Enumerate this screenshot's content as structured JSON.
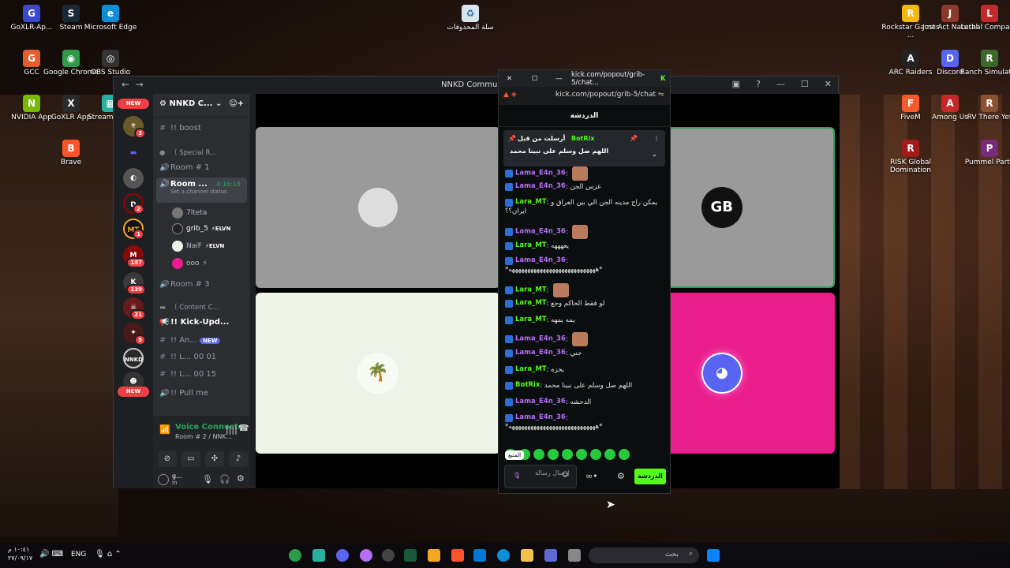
{
  "desktop_icons": [
    {
      "label": "GoXLR-Ap...",
      "color": "#3a4ad0",
      "glyph": "G",
      "col": 0,
      "row": 0
    },
    {
      "label": "Steam",
      "color": "#1b2838",
      "glyph": "S",
      "col": 1,
      "row": 0
    },
    {
      "label": "Microsoft Edge",
      "color": "#0c8fd6",
      "glyph": "e",
      "col": 2,
      "row": 0
    },
    {
      "label": "GCC",
      "color": "#e35d2f",
      "glyph": "G",
      "col": 0,
      "row": 1
    },
    {
      "label": "Google Chrome",
      "color": "#2e9b4a",
      "glyph": "◉",
      "col": 1,
      "row": 1
    },
    {
      "label": "OBS Studio",
      "color": "#333",
      "glyph": "◎",
      "col": 2,
      "row": 1
    },
    {
      "label": "NVIDIA App",
      "color": "#76b900",
      "glyph": "N",
      "col": 0,
      "row": 2
    },
    {
      "label": "GoXLR App",
      "color": "#2a2a2a",
      "glyph": "X",
      "col": 1,
      "row": 2
    },
    {
      "label": "Stream Deck",
      "color": "#2ab0a0",
      "glyph": "▦",
      "col": 2,
      "row": 2
    },
    {
      "label": "Brave",
      "color": "#fb542b",
      "glyph": "B",
      "col": 1,
      "row": 3
    }
  ],
  "recycle": "سلة المحذوفات",
  "right_icons": [
    {
      "label": "Rockstar Games ...",
      "color": "#f2b90c",
      "glyph": "R",
      "col": 0,
      "row": 0
    },
    {
      "label": "Just Act Natural",
      "color": "#8a3a2a",
      "glyph": "J",
      "col": 1,
      "row": 0
    },
    {
      "label": "Lethal Company",
      "color": "#c12a2a",
      "glyph": "L",
      "col": 2,
      "row": 0
    },
    {
      "label": "ARC Raiders",
      "color": "#222",
      "glyph": "A",
      "col": 0,
      "row": 1
    },
    {
      "label": "Discord",
      "color": "#5865f2",
      "glyph": "D",
      "col": 1,
      "row": 1
    },
    {
      "label": "Ranch Simulator",
      "color": "#3a6a2a",
      "glyph": "R",
      "col": 2,
      "row": 1
    },
    {
      "label": "FiveM",
      "color": "#f55a2a",
      "glyph": "F",
      "col": 0,
      "row": 2
    },
    {
      "label": "Among Us",
      "color": "#c62828",
      "glyph": "A",
      "col": 1,
      "row": 2
    },
    {
      "label": "RV There Yet",
      "color": "#8a5030",
      "glyph": "R",
      "col": 2,
      "row": 2
    },
    {
      "label": "RISK Global Domination",
      "color": "#a31a1a",
      "glyph": "R",
      "col": 0,
      "row": 3
    },
    {
      "label": "Pummel Party",
      "color": "#7a2a7a",
      "glyph": "P",
      "col": 2,
      "row": 3
    }
  ],
  "discord": {
    "title": "NNKD Commu",
    "server_name": "NNKD C...",
    "new_label": "NEW",
    "rail_badges": [
      "3",
      "2",
      "1",
      "187",
      "139",
      "21",
      "5"
    ],
    "channels": {
      "boost": "!! boost",
      "cat1": "〔 Special R...",
      "room1": "Room # 1",
      "room2": "Room ...",
      "room2_time": "4:16:18",
      "status": "Set a channel status",
      "users": [
        "7lteta",
        "grib_5",
        "NaiF",
        "ooo"
      ],
      "elvn": "ELVN",
      "room3": "Room # 3",
      "cat2": "〔 Content C...",
      "kick": "!! Kick-Upd...",
      "an": "!! An...",
      "an_new": "NEW",
      "l1": "!! L...",
      "l1b": "00",
      "l1c": "01",
      "l2": "!! L...",
      "l2b": "00",
      "l2c": "15",
      "pull": "!! Pull me"
    },
    "voice": {
      "status": "Voice Connecte",
      "sub": "Room # 2 / NNK..."
    },
    "user": {
      "name": "g...",
      "status": "In"
    }
  },
  "kick": {
    "window_url": "kick.com/popout/grib-5/chat...",
    "url": "kick.com/popout/grib-5/chat",
    "header": "الدردشة",
    "pin_by": "أرسلت من قبل",
    "pin_user": "BotRix",
    "pin_text": "اللهم صل وسلم على نبينا محمد",
    "messages": [
      {
        "u": "Lama_E4n_36",
        "c": "#b46ef5",
        "t": "",
        "emo": true
      },
      {
        "u": "Lama_E4n_36",
        "c": "#b46ef5",
        "t": "عرس الجن"
      },
      {
        "u": "Lara_MT",
        "c": "#53fc18",
        "t": "يمكن راح مدينه الجن الي بين العراق و",
        "t2": "ايران؟؟"
      },
      {
        "u": "Lama_E4n_36",
        "c": "#b46ef5",
        "t": "",
        "emo": true
      },
      {
        "u": "Lara_MT",
        "c": "#53fc18",
        "t": "يعهههه"
      },
      {
        "u": "Lama_E4n_36",
        "c": "#b46ef5",
        "t": "",
        "t2": "*ههههههههههههههههههههههههههههه*"
      },
      {
        "u": "Lara_MT",
        "c": "#53fc18",
        "t": "",
        "emo": true
      },
      {
        "u": "Lara_MT",
        "c": "#53fc18",
        "t": "لو فقط الحاكم وجع"
      },
      {
        "u": "Lara_MT",
        "c": "#53fc18",
        "t": "يمه يمهه"
      },
      {
        "u": "Lama_E4n_36",
        "c": "#b46ef5",
        "t": "",
        "emo": true
      },
      {
        "u": "Lama_E4n_36",
        "c": "#b46ef5",
        "t": "جني"
      },
      {
        "u": "Lara_MT",
        "c": "#53fc18",
        "t": "بخزه"
      },
      {
        "u": "BotRix",
        "c": "#53fc18",
        "t": "اللهم صل وسلم على نبينا محمد"
      },
      {
        "u": "Lama_E4n_36",
        "c": "#b46ef5",
        "t": "الدحشه"
      },
      {
        "u": "Lama_E4n_36",
        "c": "#b46ef5",
        "t": "",
        "t2": "*ههههههههههههههههههههههههههههه*"
      }
    ],
    "tooltip": "المتبع",
    "input_placeholder": "إرسال رسالة",
    "chat_button": "الدردشة"
  },
  "taskbar": {
    "time": "١٠:٤١ م",
    "date": "٢٧/٠٩/١٧",
    "lang": "ENG",
    "search": "بحث"
  }
}
